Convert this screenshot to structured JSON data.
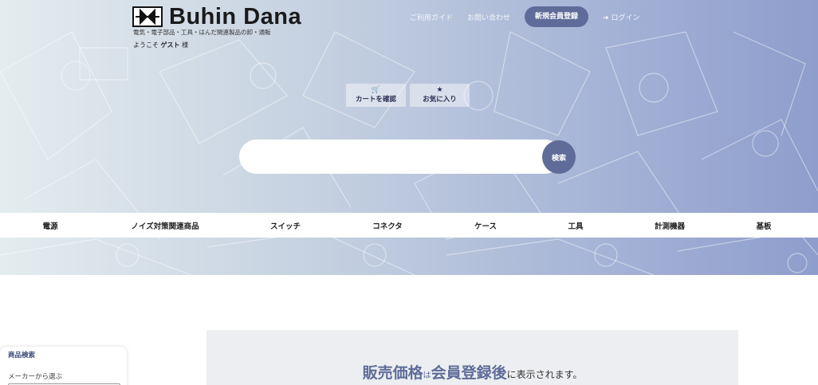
{
  "header": {
    "logo_text": "Buhin Dana",
    "tagline": "電気・電子部品・工具・はんだ関連製品の卸・通販",
    "welcome_prefix": "ようこそ ",
    "welcome_user": "ゲスト",
    "welcome_suffix": " 様"
  },
  "topnav": {
    "guide": "ご利用ガイド",
    "contact": "お問い合わせ",
    "register": "新規会員登録",
    "login": "ログイン",
    "login_icon": "login-icon"
  },
  "quick": {
    "cart_label": "カートを確認",
    "cart_icon": "cart-icon",
    "favorites_label": "お気に入り",
    "favorites_icon": "star-icon"
  },
  "search": {
    "placeholder": "",
    "button_label": "検索"
  },
  "categories": [
    "電源",
    "ノイズ対策関連商品",
    "スイッチ",
    "コネクタ",
    "ケース",
    "工具",
    "計測機器",
    "基板"
  ],
  "sidebar": {
    "title": "商品検索",
    "maker_label": "メーカーから選ぶ"
  },
  "notice": {
    "price": "販売価格",
    "particle": "は",
    "register": "会員登録後",
    "suffix": "に表示されます。"
  },
  "colors": {
    "accent": "#5f6c99",
    "hero_left": "#e4ecef",
    "hero_right": "#8e9dcc"
  }
}
